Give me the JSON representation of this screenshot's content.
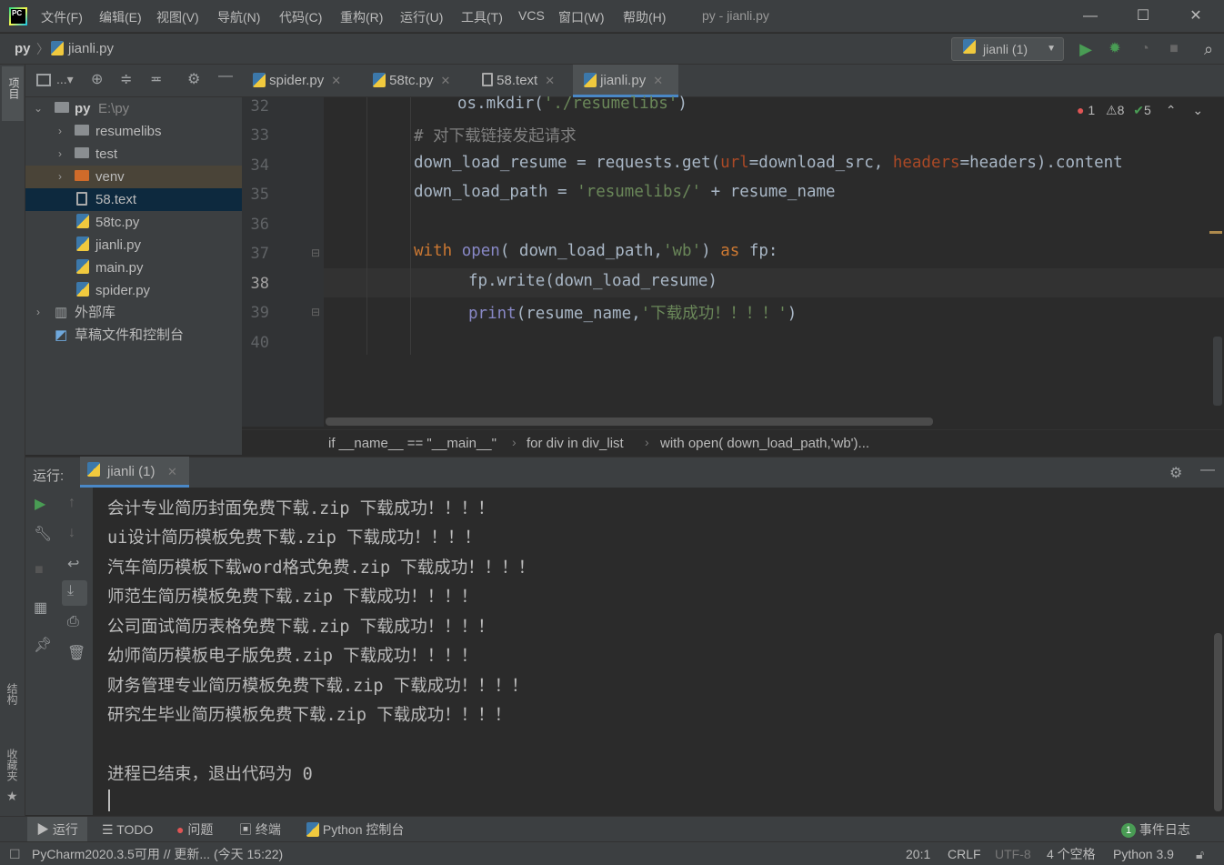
{
  "titlebar": {
    "menus": [
      "文件(F)",
      "编辑(E)",
      "视图(V)",
      "导航(N)",
      "代码(C)",
      "重构(R)",
      "运行(U)",
      "工具(T)",
      "VCS",
      "窗口(W)",
      "帮助(H)"
    ],
    "window_title": "py - jianli.py",
    "logo_text": "PC"
  },
  "navbar": {
    "project": "py",
    "file": "jianli.py",
    "run_config": "jianli (1)"
  },
  "leftstrip": {
    "project_label": "项目",
    "structure_label": "结构",
    "favorites_label": "收藏夹"
  },
  "project": {
    "root_name": "py",
    "root_path": "E:\\py",
    "items": [
      {
        "label": "resumelibs"
      },
      {
        "label": "test"
      },
      {
        "label": "venv"
      },
      {
        "label": "58.text"
      },
      {
        "label": "58tc.py"
      },
      {
        "label": "jianli.py"
      },
      {
        "label": "main.py"
      },
      {
        "label": "spider.py"
      },
      {
        "label": "外部库"
      },
      {
        "label": "草稿文件和控制台"
      }
    ]
  },
  "tabs": [
    {
      "label": "spider.py"
    },
    {
      "label": "58tc.py"
    },
    {
      "label": "58.text"
    },
    {
      "label": "jianli.py"
    }
  ],
  "editor": {
    "line_numbers": [
      "32",
      "33",
      "34",
      "35",
      "36",
      "37",
      "38",
      "39",
      "40"
    ],
    "code": {
      "l32a": "os.mkdir(",
      "l32b": "'./resumelibs'",
      "l32c": ")",
      "l33": "# 对下载链接发起请求",
      "l34a": "down_load_resume = requests.get(",
      "l34b": "url",
      "l34c": "=download_src, ",
      "l34d": "headers",
      "l34e": "=headers).content",
      "l35a": "down_load_path = ",
      "l35b": "'resumelibs/'",
      "l35c": " + resume_name",
      "l37a": "with",
      "l37b": " ",
      "l37c": "open",
      "l37d": "( down_load_path,",
      "l37e": "'wb'",
      "l37f": ") ",
      "l37g": "as",
      "l37h": " fp:",
      "l38": "fp.write(down_load_resume)",
      "l39a": "print",
      "l39b": "(resume_name,",
      "l39c": "'下载成功！！！！'",
      "l39d": ")"
    },
    "inspections": {
      "errors": "1",
      "warnings": "8",
      "ok": "5"
    },
    "breadcrumbs": [
      "if __name__ == \"__main__\"",
      "for div in div_list",
      "with open( down_load_path,'wb')..."
    ]
  },
  "run": {
    "label": "运行:",
    "tab": "jianli (1)",
    "console_lines": [
      "会计专业简历封面免费下载.zip 下载成功！！！！",
      "ui设计简历模板免费下载.zip 下载成功！！！！",
      "汽车简历模板下载word格式免费.zip 下载成功！！！！",
      "师范生简历模板免费下载.zip 下载成功！！！！",
      "公司面试简历表格免费下载.zip 下载成功！！！！",
      "幼师简历模板电子版免费.zip 下载成功！！！！",
      "财务管理专业简历模板免费下载.zip 下载成功！！！！",
      "研究生毕业简历模板免费下载.zip 下载成功！！！！",
      "",
      "进程已结束，退出代码为 0"
    ]
  },
  "tooltabs": {
    "run": "运行",
    "todo": "TODO",
    "problems": "问题",
    "terminal": "终端",
    "python_console": "Python 控制台",
    "event_log": "事件日志",
    "event_count": "1"
  },
  "statusbar": {
    "message": "PyCharm2020.3.5可用 // 更新... (今天 15:22)",
    "position": "20:1",
    "line_sep": "CRLF",
    "encoding": "UTF-8",
    "indent": "4 个空格",
    "interpreter": "Python 3.9"
  }
}
